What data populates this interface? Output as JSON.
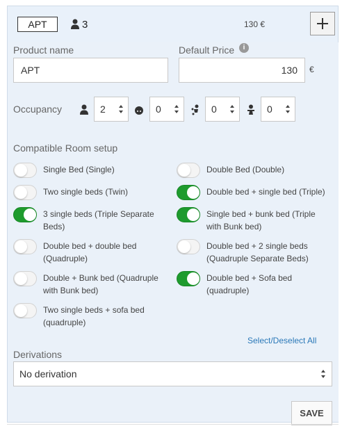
{
  "header": {
    "code": "APT",
    "occupancy_icon": "person-icon",
    "occupancy": "3",
    "price": "130 €",
    "add_icon": "plus-icon"
  },
  "form": {
    "product_name_label": "Product name",
    "product_name_value": "APT",
    "default_price_label": "Default Price",
    "info_icon": "info-icon",
    "default_price_value": "130",
    "currency": "€"
  },
  "occupancy": {
    "label": "Occupancy",
    "fields": [
      {
        "icon": "adult-icon",
        "value": "2"
      },
      {
        "icon": "child-icon",
        "value": "0"
      },
      {
        "icon": "toddler-icon",
        "value": "0"
      },
      {
        "icon": "baby-icon",
        "value": "0"
      }
    ]
  },
  "rooms": {
    "label": "Compatible Room setup",
    "items": [
      {
        "label": "Single Bed (Single)",
        "on": false
      },
      {
        "label": "Double Bed (Double)",
        "on": false
      },
      {
        "label": "Two single beds (Twin)",
        "on": false
      },
      {
        "label": "Double bed + single bed (Triple)",
        "on": true
      },
      {
        "label": "3 single beds (Triple Separate Beds)",
        "on": true
      },
      {
        "label": "Single bed + bunk bed (Triple with Bunk bed)",
        "on": true
      },
      {
        "label": "Double bed + double bed (Quadruple)",
        "on": false
      },
      {
        "label": "Double bed + 2 single beds (Quadruple Separate Beds)",
        "on": false
      },
      {
        "label": "Double + Bunk bed (Quadruple with Bunk bed)",
        "on": false
      },
      {
        "label": "Double bed + Sofa bed (quadruple)",
        "on": true
      },
      {
        "label": "Two single beds + sofa bed (quadruple)",
        "on": false
      }
    ],
    "select_all": "Select/Deselect All"
  },
  "derivations": {
    "label": "Derivations",
    "selected": "No derivation"
  },
  "save_label": "SAVE",
  "colors": {
    "panel_bg": "#e9f1fa",
    "toggle_on": "#1e9b2e",
    "link": "#2a78b8"
  }
}
